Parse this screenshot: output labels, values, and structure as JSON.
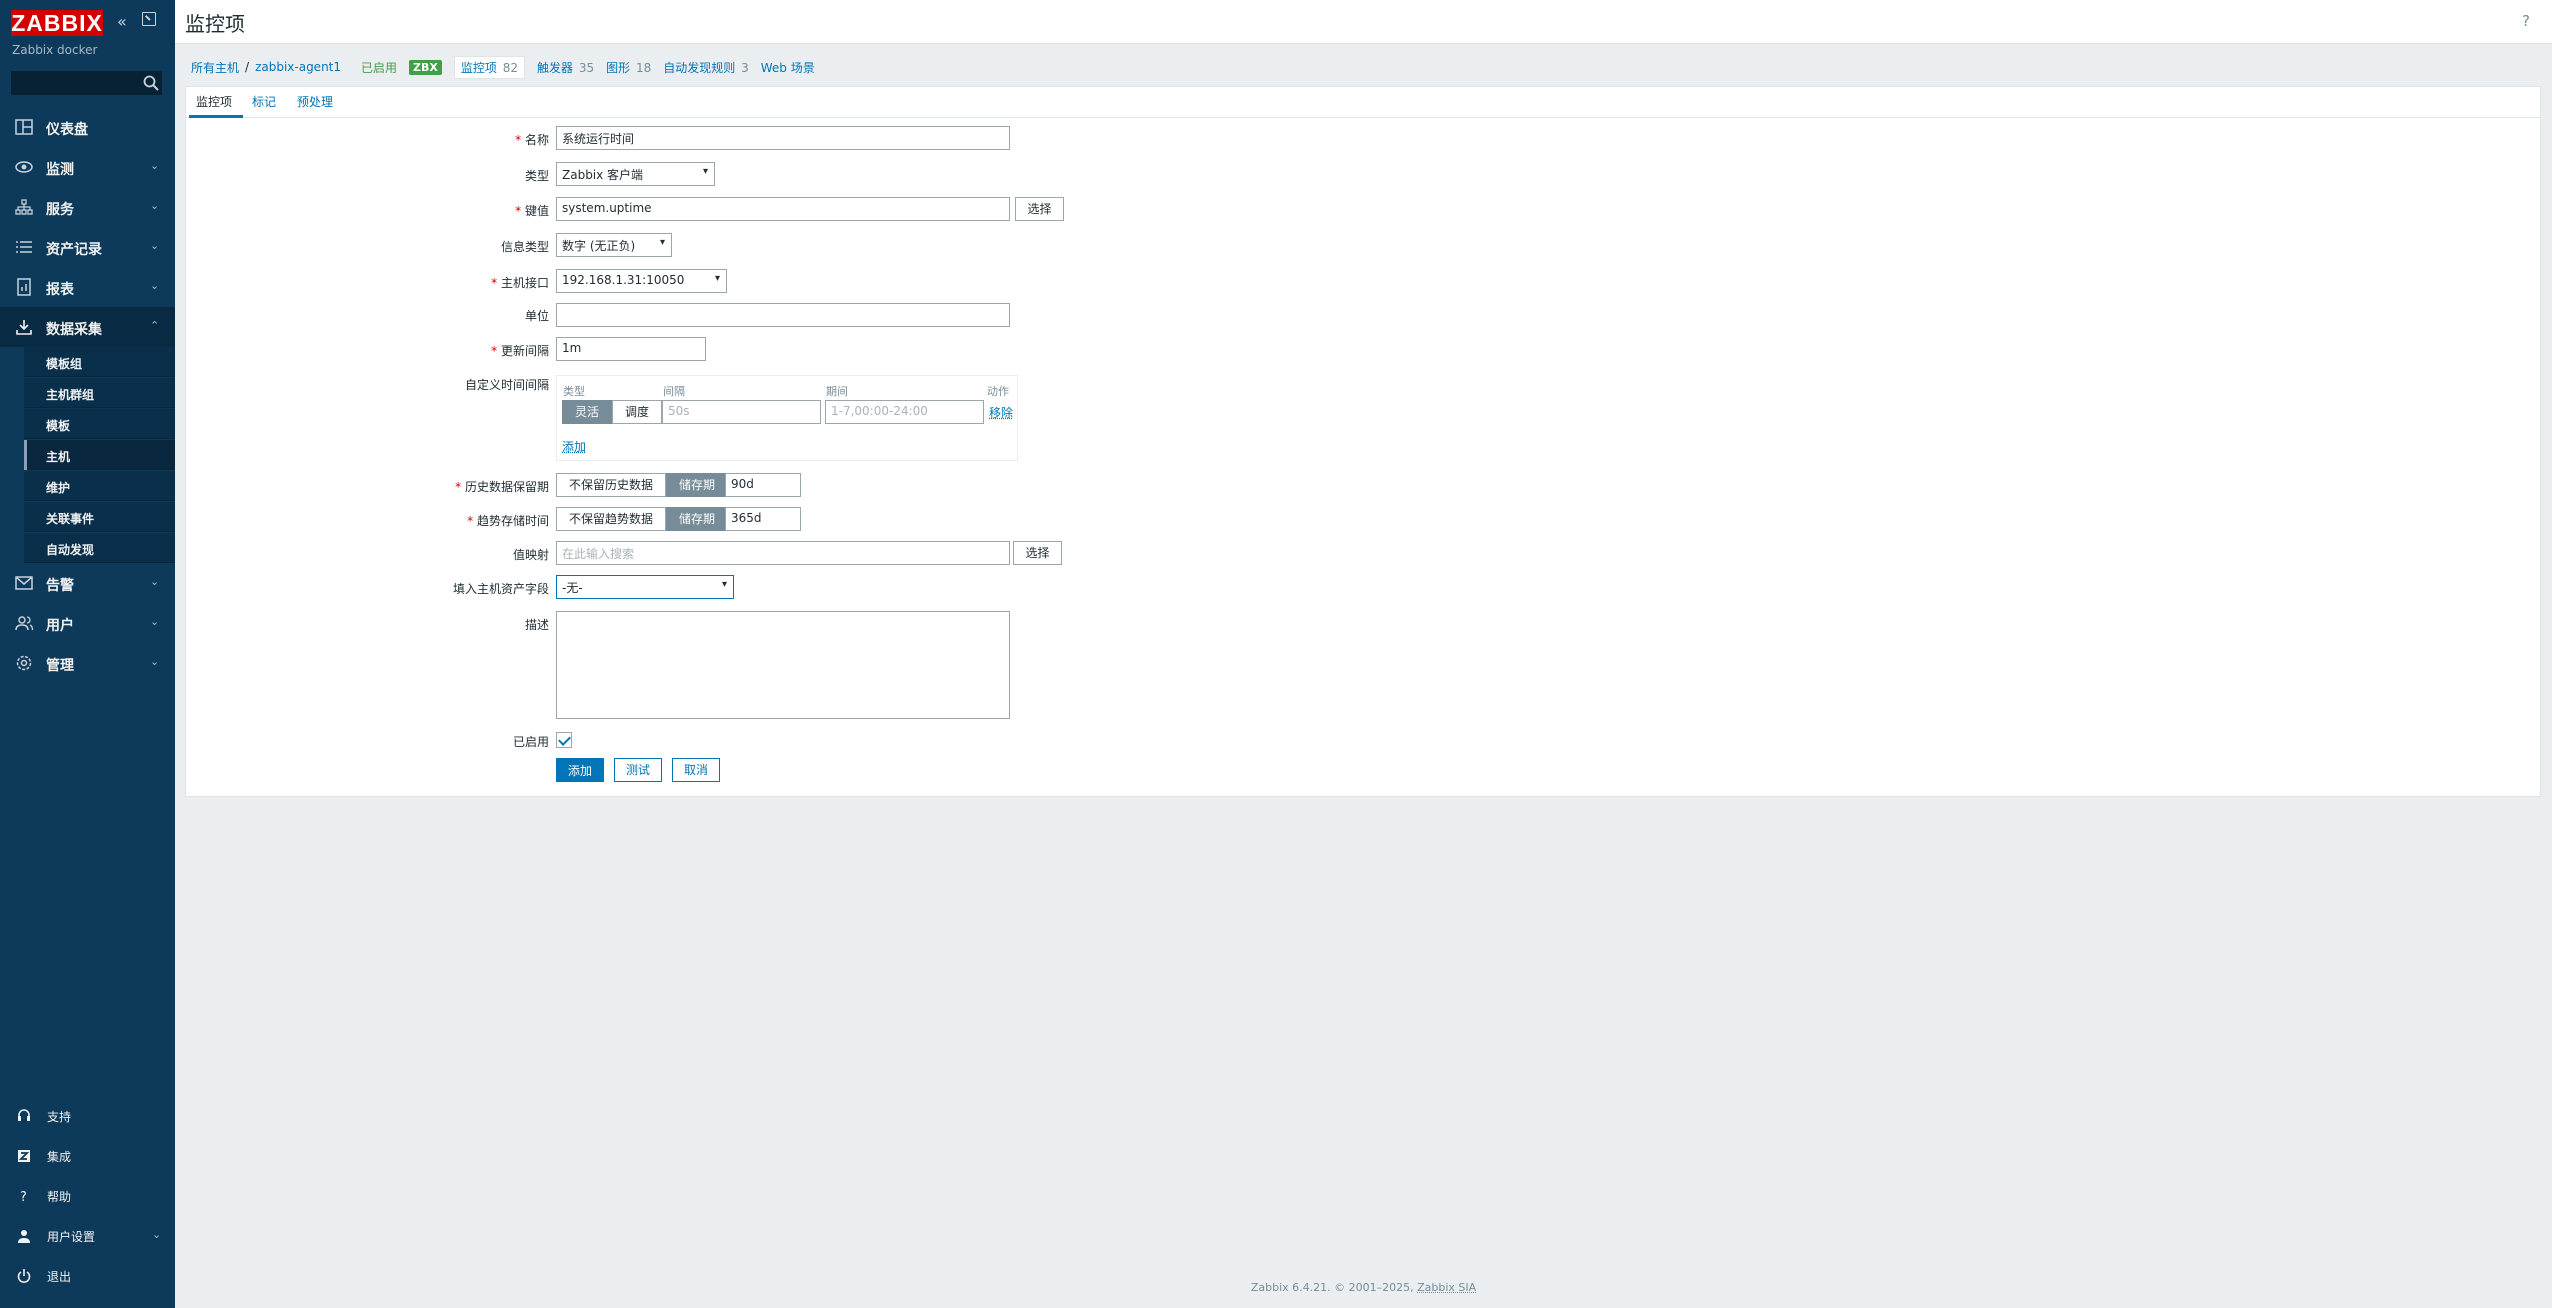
{
  "app": {
    "logo": "ZABBIX",
    "server_name": "Zabbix docker",
    "search_placeholder": ""
  },
  "sidebar": {
    "items": [
      {
        "label": "仪表盘",
        "icon": "dashboard-icon"
      },
      {
        "label": "监测",
        "icon": "eye-icon"
      },
      {
        "label": "服务",
        "icon": "services-icon"
      },
      {
        "label": "资产记录",
        "icon": "inventory-icon"
      },
      {
        "label": "报表",
        "icon": "reports-icon"
      },
      {
        "label": "数据采集",
        "icon": "download-icon"
      },
      {
        "label": "告警",
        "icon": "mail-icon"
      },
      {
        "label": "用户",
        "icon": "users-icon"
      },
      {
        "label": "管理",
        "icon": "gear-icon"
      }
    ],
    "sub_items": [
      "模板组",
      "主机群组",
      "模板",
      "主机",
      "维护",
      "关联事件",
      "自动发现"
    ],
    "bottom": [
      {
        "label": "支持",
        "icon": "headset-icon"
      },
      {
        "label": "集成",
        "icon": "integrations-icon"
      },
      {
        "label": "帮助",
        "icon": "help-icon"
      },
      {
        "label": "用户设置",
        "icon": "user-icon"
      },
      {
        "label": "退出",
        "icon": "power-icon"
      }
    ]
  },
  "header": {
    "title": "监控项",
    "help": "?"
  },
  "breadcrumb": {
    "all_hosts": "所有主机",
    "sep": "/",
    "host": "zabbix-agent1",
    "status": "已启用",
    "zbx": "ZBX",
    "items_label": "监控项",
    "items_count": "82",
    "triggers_label": "触发器",
    "triggers_count": "35",
    "graphs_label": "图形",
    "graphs_count": "18",
    "discovery_label": "自动发现规则",
    "discovery_count": "3",
    "web_label": "Web 场景"
  },
  "tabs": [
    "监控项",
    "标记",
    "预处理"
  ],
  "form": {
    "name_label": "名称",
    "name_value": "系统运行时间",
    "type_label": "类型",
    "type_value": "Zabbix 客户端",
    "key_label": "键值",
    "key_value": "system.uptime",
    "select_btn": "选择",
    "info_type_label": "信息类型",
    "info_type_value": "数字 (无正负)",
    "interface_label": "主机接口",
    "interface_value": "192.168.1.31:10050",
    "units_label": "单位",
    "units_value": "",
    "interval_label": "更新间隔",
    "interval_value": "1m",
    "custom_intervals_label": "自定义时间间隔",
    "ci_head_type": "类型",
    "ci_head_interval": "间隔",
    "ci_head_period": "期间",
    "ci_head_action": "动作",
    "ci_flexible": "灵活",
    "ci_scheduling": "调度",
    "ci_interval_placeholder": "50s",
    "ci_period_placeholder": "1-7,00:00-24:00",
    "ci_remove": "移除",
    "ci_add": "添加",
    "history_label": "历史数据保留期",
    "history_no": "不保留历史数据",
    "history_store": "储存期",
    "history_value": "90d",
    "trends_label": "趋势存储时间",
    "trends_no": "不保留趋势数据",
    "trends_store": "储存期",
    "trends_value": "365d",
    "valuemap_label": "值映射",
    "valuemap_placeholder": "在此输入搜索",
    "valuemap_select": "选择",
    "inventory_label": "填入主机资产字段",
    "inventory_value": "-无-",
    "description_label": "描述",
    "enabled_label": "已启用",
    "add_btn": "添加",
    "test_btn": "测试",
    "cancel_btn": "取消"
  },
  "footer": {
    "text": "Zabbix 6.4.21. © 2001–2025,",
    "link": "Zabbix SIA"
  },
  "colors": {
    "sidebar": "#0d3a5a",
    "accent": "#0275b8",
    "logo": "#d40000",
    "enabled": "#429e47"
  }
}
